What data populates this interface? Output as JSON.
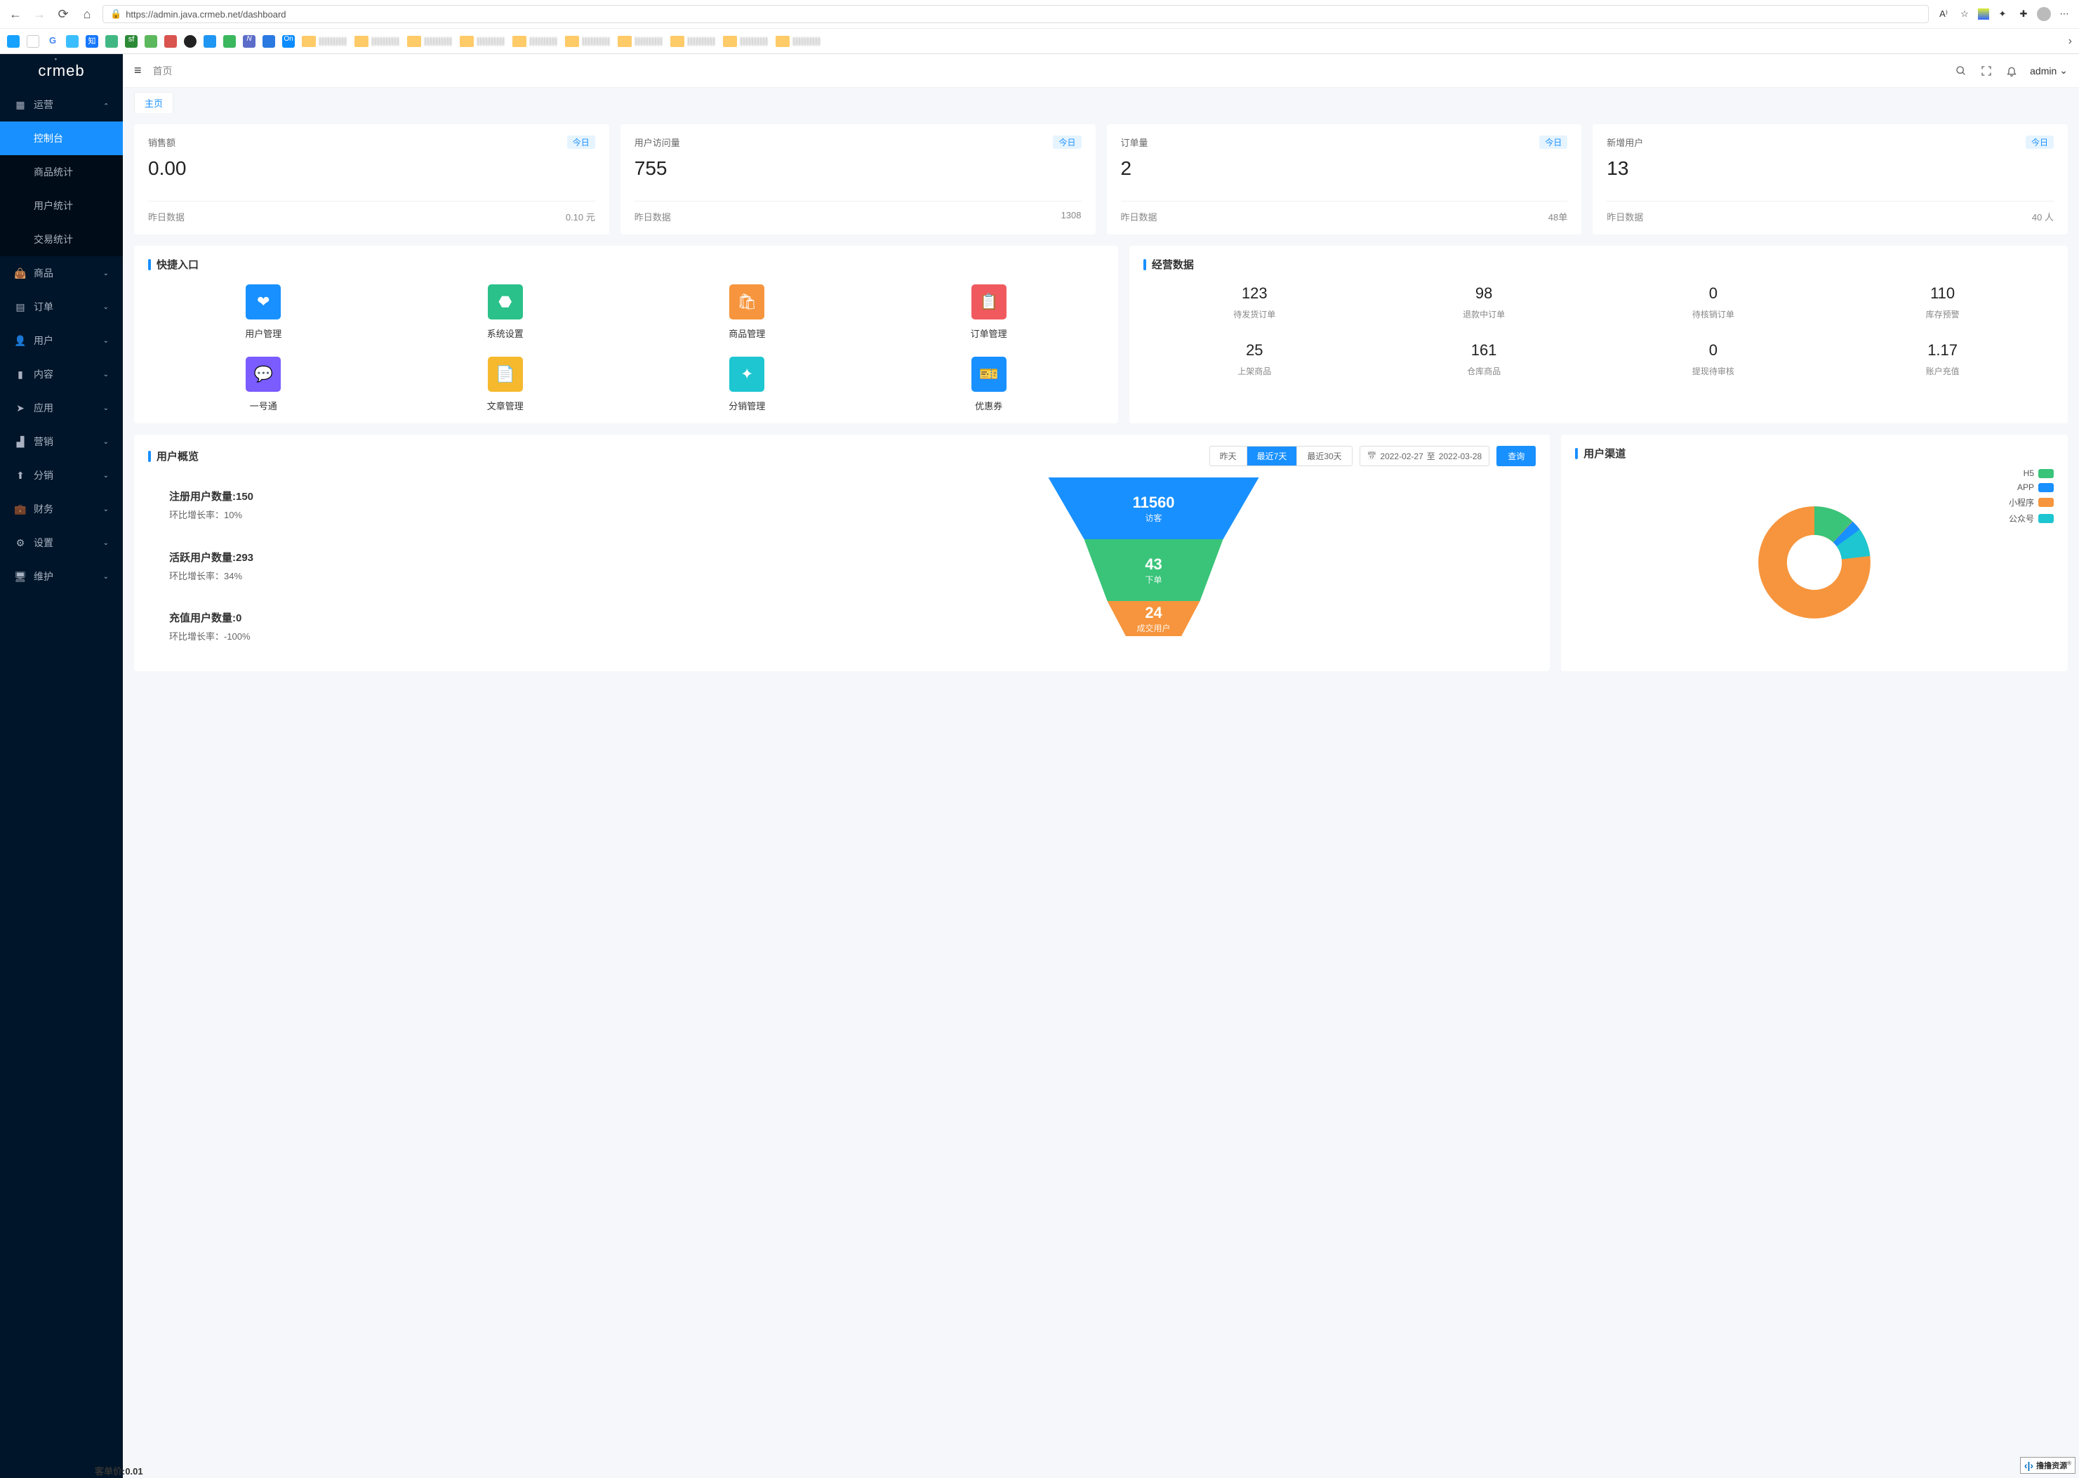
{
  "browser": {
    "url": "https://admin.java.crmeb.net/dashboard"
  },
  "topbar": {
    "breadcrumb": "首页",
    "user_name": "admin"
  },
  "tabs": {
    "active": "主页"
  },
  "sidebar": {
    "logo_text": "crmeb",
    "groups": [
      {
        "label": "运营",
        "icon": "grid",
        "expanded": true,
        "children": [
          {
            "label": "控制台",
            "active": true
          },
          {
            "label": "商品统计",
            "active": false
          },
          {
            "label": "用户统计",
            "active": false
          },
          {
            "label": "交易统计",
            "active": false
          }
        ]
      },
      {
        "label": "商品",
        "icon": "bag"
      },
      {
        "label": "订单",
        "icon": "list"
      },
      {
        "label": "用户",
        "icon": "user"
      },
      {
        "label": "内容",
        "icon": "book"
      },
      {
        "label": "应用",
        "icon": "send"
      },
      {
        "label": "营销",
        "icon": "chart"
      },
      {
        "label": "分销",
        "icon": "share"
      },
      {
        "label": "财务",
        "icon": "wallet"
      },
      {
        "label": "设置",
        "icon": "gear"
      },
      {
        "label": "维护",
        "icon": "display"
      }
    ]
  },
  "stat_tag": "今日",
  "stats": [
    {
      "title": "销售额",
      "value": "0.00",
      "yesterday_label": "昨日数据",
      "yesterday_value": "0.10 元"
    },
    {
      "title": "用户访问量",
      "value": "755",
      "yesterday_label": "昨日数据",
      "yesterday_value": "1308"
    },
    {
      "title": "订单量",
      "value": "2",
      "yesterday_label": "昨日数据",
      "yesterday_value": "48单"
    },
    {
      "title": "新增用户",
      "value": "13",
      "yesterday_label": "昨日数据",
      "yesterday_value": "40 人"
    }
  ],
  "quick": {
    "title": "快捷入口",
    "items": [
      {
        "label": "用户管理",
        "color": "#1890ff",
        "glyph": "❤"
      },
      {
        "label": "系统设置",
        "color": "#2bc18b",
        "glyph": "⬣"
      },
      {
        "label": "商品管理",
        "color": "#f6953d",
        "glyph": "🛍"
      },
      {
        "label": "订单管理",
        "color": "#f05a5f",
        "glyph": "📋"
      },
      {
        "label": "一号通",
        "color": "#7a5cff",
        "glyph": "💬"
      },
      {
        "label": "文章管理",
        "color": "#f6b92e",
        "glyph": "📄"
      },
      {
        "label": "分销管理",
        "color": "#1dc6d0",
        "glyph": "✦"
      },
      {
        "label": "优惠券",
        "color": "#1890ff",
        "glyph": "🎫"
      }
    ]
  },
  "biz": {
    "title": "经营数据",
    "items": [
      {
        "value": "123",
        "label": "待发货订单"
      },
      {
        "value": "98",
        "label": "退款中订单"
      },
      {
        "value": "0",
        "label": "待核销订单"
      },
      {
        "value": "110",
        "label": "库存预警"
      },
      {
        "value": "25",
        "label": "上架商品"
      },
      {
        "value": "161",
        "label": "仓库商品"
      },
      {
        "value": "0",
        "label": "提现待审核"
      },
      {
        "value": "1.17",
        "label": "账户充值"
      }
    ]
  },
  "overview": {
    "title": "用户概览",
    "seg": [
      "昨天",
      "最近7天",
      "最近30天"
    ],
    "seg_active": 1,
    "date_from": "2022-02-27",
    "date_sep": "至",
    "date_to": "2022-03-28",
    "query_btn": "查询",
    "stats": [
      {
        "title": "注册用户数量:150",
        "sub": "环比增长率：10%"
      },
      {
        "title": "活跃用户数量:293",
        "sub": "环比增长率：34%"
      },
      {
        "title": "充值用户数量:0",
        "sub": "环比增长率：-100%"
      }
    ],
    "extra": "客单价:0.01",
    "funnel": [
      {
        "value": "11560",
        "label": "访客",
        "color": "#1890ff",
        "width": 100
      },
      {
        "value": "43",
        "label": "下单",
        "color": "#39c479",
        "width": 66
      },
      {
        "value": "24",
        "label": "成交用户",
        "color": "#f6953d",
        "width": 44
      }
    ]
  },
  "channel": {
    "title": "用户渠道",
    "legend": [
      {
        "label": "H5",
        "color": "#39c479"
      },
      {
        "label": "APP",
        "color": "#1890ff"
      },
      {
        "label": "小程序",
        "color": "#f6953d"
      },
      {
        "label": "公众号",
        "color": "#1dc6d0"
      }
    ]
  },
  "chart_data": [
    {
      "type": "funnel",
      "title": "用户概览",
      "series": [
        {
          "name": "访客",
          "value": 11560
        },
        {
          "name": "下单",
          "value": 43
        },
        {
          "name": "成交用户",
          "value": 24
        }
      ]
    },
    {
      "type": "pie",
      "title": "用户渠道",
      "series": [
        {
          "name": "H5",
          "value_pct": 12
        },
        {
          "name": "APP",
          "value_pct": 3
        },
        {
          "name": "小程序",
          "value_pct": 77
        },
        {
          "name": "公众号",
          "value_pct": 8
        }
      ]
    }
  ],
  "watermark": {
    "brand": "撸撸资源",
    "sub": "+|+"
  }
}
